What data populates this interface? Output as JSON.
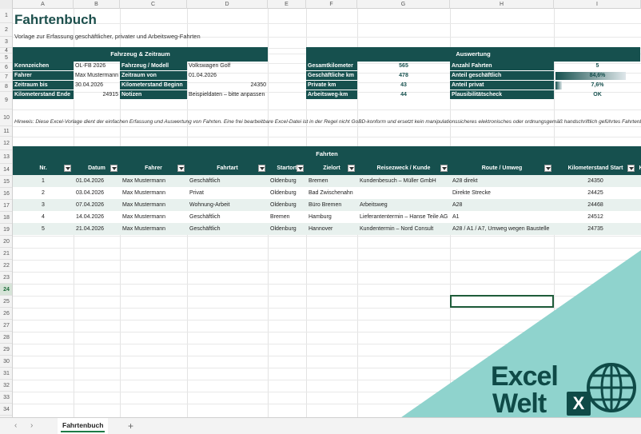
{
  "columns": [
    "A",
    "B",
    "C",
    "D",
    "E",
    "F",
    "G",
    "H",
    "I"
  ],
  "rows": [
    "1",
    "2",
    "3",
    "4",
    "5",
    "6",
    "7",
    "8",
    "9",
    "10",
    "11",
    "12",
    "13",
    "14",
    "15",
    "16",
    "17",
    "18",
    "19",
    "20",
    "21",
    "22",
    "23",
    "24",
    "25",
    "26",
    "27",
    "28",
    "29",
    "30",
    "31",
    "32",
    "33",
    "34"
  ],
  "selected_row": "24",
  "title": "Fahrtenbuch",
  "subtitle": "Vorlage zur Erfassung geschäftlicher, privater und Arbeitsweg-Fahrten",
  "vehicle": {
    "header": "Fahrzeug & Zeitraum",
    "rows": [
      {
        "l1": "Kennzeichen",
        "v1": "OL-FB 2026",
        "l2": "Fahrzeug / Modell",
        "v2": "Volkswagen Golf"
      },
      {
        "l1": "Fahrer",
        "v1": "Max Mustermann",
        "l2": "Zeitraum von",
        "v2": "01.04.2026"
      },
      {
        "l1": "Zeitraum bis",
        "v1": "30.04.2026",
        "l2": "Kilometerstand Beginn",
        "v2": "24350"
      },
      {
        "l1": "Kilometerstand Ende",
        "v1": "24915",
        "l2": "Notizen",
        "v2": "Beispieldaten – bitte anpassen"
      }
    ]
  },
  "eval": {
    "header": "Auswertung",
    "rows": [
      {
        "l1": "Gesamtkilometer",
        "v1": "565",
        "l2": "Anzahl Fahrten",
        "v2": "5"
      },
      {
        "l1": "Geschäftliche km",
        "v1": "478",
        "l2": "Anteil geschäftlich",
        "v2": "84,6%"
      },
      {
        "l1": "Private km",
        "v1": "43",
        "l2": "Anteil privat",
        "v2": "7,6%"
      },
      {
        "l1": "Arbeitsweg-km",
        "v1": "44",
        "l2": "Plausibilitätscheck",
        "v2": "OK"
      }
    ],
    "share_business": 0.846,
    "share_private": 0.076
  },
  "hint": "Hinweis: Diese Excel-Vorlage dient der einfachen Erfassung und Auswertung von Fahrten. Eine frei bearbeitbare Excel-Datei ist in der Regel nicht GoBD-konform und ersetzt kein manipulationssicheres elektronisches oder ordnungsgemäß handschriftlich geführtes Fahrtenbuch.",
  "trips": {
    "header": "Fahrten",
    "columns": [
      "Nr.",
      "Datum",
      "Fahrer",
      "Fahrtart",
      "Startort",
      "Zielort",
      "Reisezweck / Kunde",
      "Route / Umweg",
      "Kilometerstand Start",
      "K"
    ],
    "rows": [
      [
        "1",
        "01.04.2026",
        "Max Mustermann",
        "Geschäftlich",
        "Oldenburg",
        "Bremen",
        "Kundenbesuch – Müller GmbH",
        "A28 direkt",
        "24350"
      ],
      [
        "2",
        "03.04.2026",
        "Max Mustermann",
        "Privat",
        "Oldenburg",
        "Bad Zwischenahn",
        "",
        "Direkte Strecke",
        "24425"
      ],
      [
        "3",
        "07.04.2026",
        "Max Mustermann",
        "Wohnung-Arbeit",
        "Oldenburg",
        "Büro Bremen",
        "Arbeitsweg",
        "A28",
        "24468"
      ],
      [
        "4",
        "14.04.2026",
        "Max Mustermann",
        "Geschäftlich",
        "Bremen",
        "Hamburg",
        "Lieferantentermin – Hanse Teile AG",
        "A1",
        "24512"
      ],
      [
        "5",
        "21.04.2026",
        "Max Mustermann",
        "Geschäftlich",
        "Oldenburg",
        "Hannover",
        "Kundentermin – Nord Consult",
        "A28 / A1 / A7, Umweg wegen Baustelle",
        "24735"
      ]
    ]
  },
  "sheet_tab": "Fahrtenbuch",
  "add_sheet": "+",
  "nav_prev": "‹",
  "nav_next": "›",
  "watermark": {
    "line1": "Excel",
    "line2": "Welt",
    "badge": "X"
  },
  "colors": {
    "header": "#16504e",
    "accent": "#1e7a46",
    "row_alt": "#e8f1ee"
  }
}
